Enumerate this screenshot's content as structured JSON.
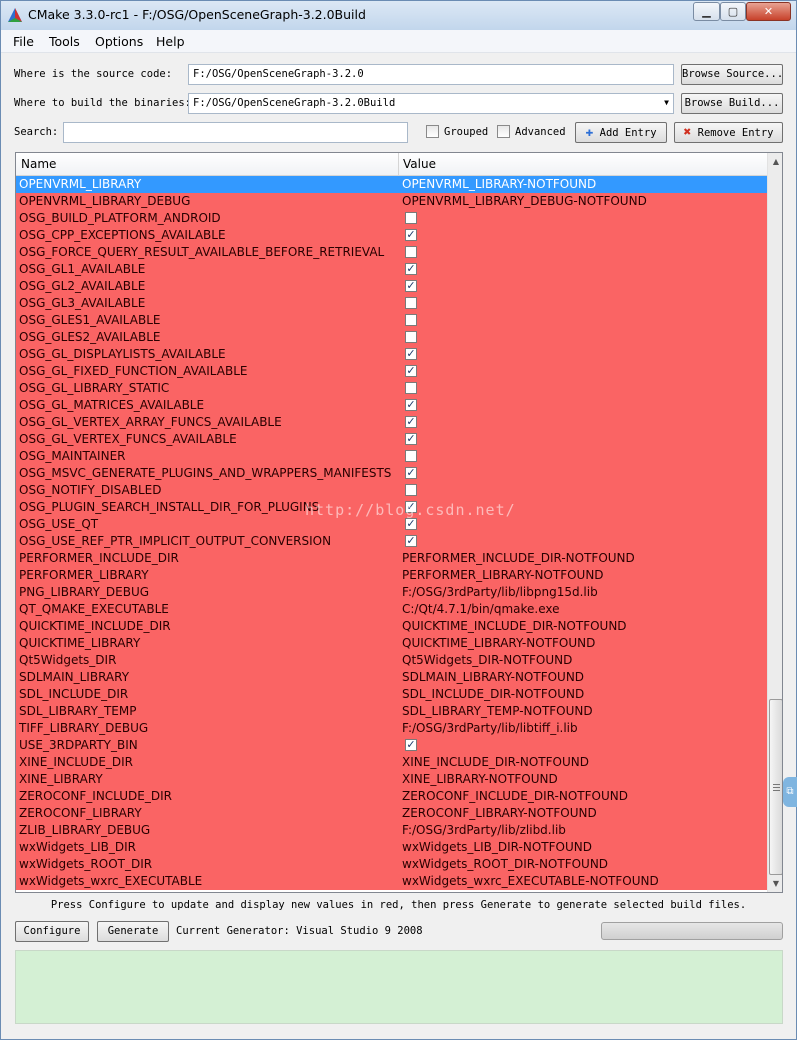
{
  "window": {
    "title": "CMake 3.3.0-rc1 - F:/OSG/OpenSceneGraph-3.2.0Build",
    "minimize_glyph": "▁",
    "maximize_glyph": "▢",
    "close_glyph": "✕"
  },
  "menu": [
    "File",
    "Tools",
    "Options",
    "Help"
  ],
  "source": {
    "label": "Where is the source code:",
    "value": "F:/OSG/OpenSceneGraph-3.2.0",
    "browse_label": "Browse Source..."
  },
  "build": {
    "label": "Where to build the binaries:",
    "value": "F:/OSG/OpenSceneGraph-3.2.0Build",
    "browse_label": "Browse Build..."
  },
  "search": {
    "label": "Search:",
    "value": ""
  },
  "options": {
    "grouped_label": "Grouped",
    "grouped_checked": false,
    "advanced_label": "Advanced",
    "advanced_checked": false
  },
  "buttons": {
    "add_entry": "Add Entry",
    "remove_entry": "Remove Entry",
    "configure": "Configure",
    "generate": "Generate"
  },
  "table": {
    "col_name": "Name",
    "col_value": "Value",
    "rows": [
      {
        "name": "OPENVRML_LIBRARY",
        "value": "OPENVRML_LIBRARY-NOTFOUND",
        "selected": true
      },
      {
        "name": "OPENVRML_LIBRARY_DEBUG",
        "value": "OPENVRML_LIBRARY_DEBUG-NOTFOUND"
      },
      {
        "name": "OSG_BUILD_PLATFORM_ANDROID",
        "checked": false
      },
      {
        "name": "OSG_CPP_EXCEPTIONS_AVAILABLE",
        "checked": true
      },
      {
        "name": "OSG_FORCE_QUERY_RESULT_AVAILABLE_BEFORE_RETRIEVAL",
        "checked": false
      },
      {
        "name": "OSG_GL1_AVAILABLE",
        "checked": true
      },
      {
        "name": "OSG_GL2_AVAILABLE",
        "checked": true
      },
      {
        "name": "OSG_GL3_AVAILABLE",
        "checked": false
      },
      {
        "name": "OSG_GLES1_AVAILABLE",
        "checked": false
      },
      {
        "name": "OSG_GLES2_AVAILABLE",
        "checked": false
      },
      {
        "name": "OSG_GL_DISPLAYLISTS_AVAILABLE",
        "checked": true
      },
      {
        "name": "OSG_GL_FIXED_FUNCTION_AVAILABLE",
        "checked": true
      },
      {
        "name": "OSG_GL_LIBRARY_STATIC",
        "checked": false
      },
      {
        "name": "OSG_GL_MATRICES_AVAILABLE",
        "checked": true
      },
      {
        "name": "OSG_GL_VERTEX_ARRAY_FUNCS_AVAILABLE",
        "checked": true
      },
      {
        "name": "OSG_GL_VERTEX_FUNCS_AVAILABLE",
        "checked": true
      },
      {
        "name": "OSG_MAINTAINER",
        "checked": false
      },
      {
        "name": "OSG_MSVC_GENERATE_PLUGINS_AND_WRAPPERS_MANIFESTS",
        "checked": true
      },
      {
        "name": "OSG_NOTIFY_DISABLED",
        "checked": false
      },
      {
        "name": "OSG_PLUGIN_SEARCH_INSTALL_DIR_FOR_PLUGINS",
        "checked": true
      },
      {
        "name": "OSG_USE_QT",
        "checked": true
      },
      {
        "name": "OSG_USE_REF_PTR_IMPLICIT_OUTPUT_CONVERSION",
        "checked": true
      },
      {
        "name": "PERFORMER_INCLUDE_DIR",
        "value": "PERFORMER_INCLUDE_DIR-NOTFOUND"
      },
      {
        "name": "PERFORMER_LIBRARY",
        "value": "PERFORMER_LIBRARY-NOTFOUND"
      },
      {
        "name": "PNG_LIBRARY_DEBUG",
        "value": "F:/OSG/3rdParty/lib/libpng15d.lib"
      },
      {
        "name": "QT_QMAKE_EXECUTABLE",
        "value": "C:/Qt/4.7.1/bin/qmake.exe"
      },
      {
        "name": "QUICKTIME_INCLUDE_DIR",
        "value": "QUICKTIME_INCLUDE_DIR-NOTFOUND"
      },
      {
        "name": "QUICKTIME_LIBRARY",
        "value": "QUICKTIME_LIBRARY-NOTFOUND"
      },
      {
        "name": "Qt5Widgets_DIR",
        "value": "Qt5Widgets_DIR-NOTFOUND"
      },
      {
        "name": "SDLMAIN_LIBRARY",
        "value": "SDLMAIN_LIBRARY-NOTFOUND"
      },
      {
        "name": "SDL_INCLUDE_DIR",
        "value": "SDL_INCLUDE_DIR-NOTFOUND"
      },
      {
        "name": "SDL_LIBRARY_TEMP",
        "value": "SDL_LIBRARY_TEMP-NOTFOUND"
      },
      {
        "name": "TIFF_LIBRARY_DEBUG",
        "value": "F:/OSG/3rdParty/lib/libtiff_i.lib"
      },
      {
        "name": "USE_3RDPARTY_BIN",
        "checked": true
      },
      {
        "name": "XINE_INCLUDE_DIR",
        "value": "XINE_INCLUDE_DIR-NOTFOUND"
      },
      {
        "name": "XINE_LIBRARY",
        "value": "XINE_LIBRARY-NOTFOUND"
      },
      {
        "name": "ZEROCONF_INCLUDE_DIR",
        "value": "ZEROCONF_INCLUDE_DIR-NOTFOUND"
      },
      {
        "name": "ZEROCONF_LIBRARY",
        "value": "ZEROCONF_LIBRARY-NOTFOUND"
      },
      {
        "name": "ZLIB_LIBRARY_DEBUG",
        "value": "F:/OSG/3rdParty/lib/zlibd.lib"
      },
      {
        "name": "wxWidgets_LIB_DIR",
        "value": "wxWidgets_LIB_DIR-NOTFOUND"
      },
      {
        "name": "wxWidgets_ROOT_DIR",
        "value": "wxWidgets_ROOT_DIR-NOTFOUND"
      },
      {
        "name": "wxWidgets_wxrc_EXECUTABLE",
        "value": "wxWidgets_wxrc_EXECUTABLE-NOTFOUND"
      }
    ]
  },
  "watermark": "http://blog.csdn.net/",
  "hint": "Press Configure to update and display new values in red, then press Generate to generate selected build files.",
  "generator": "Current Generator: Visual Studio 9 2008",
  "colors": {
    "new_value_red": "#fa6464",
    "selection_blue": "#3399ff",
    "output_green": "#d4f0d4"
  }
}
